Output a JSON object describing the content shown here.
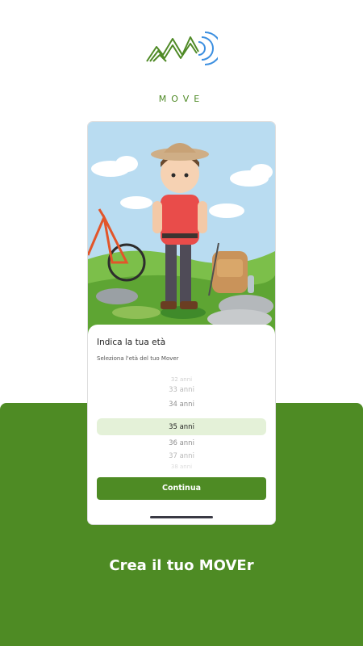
{
  "brand": {
    "name": "MOVE"
  },
  "onboarding": {
    "title": "Indica la tua età",
    "subtitle": "Seleziona l'età del tuo Mover",
    "age_options": [
      "32 anni",
      "33 anni",
      "34 anni",
      "35 anni",
      "36 anni",
      "37 anni",
      "38 anni"
    ],
    "selected_age": "35 anni",
    "continue_label": "Continua"
  },
  "tagline": "Crea il tuo MOVEr",
  "colors": {
    "brand_green": "#4e8b24",
    "logo_blue": "#3c8fe0",
    "selection_bg": "#e4f1d8"
  }
}
